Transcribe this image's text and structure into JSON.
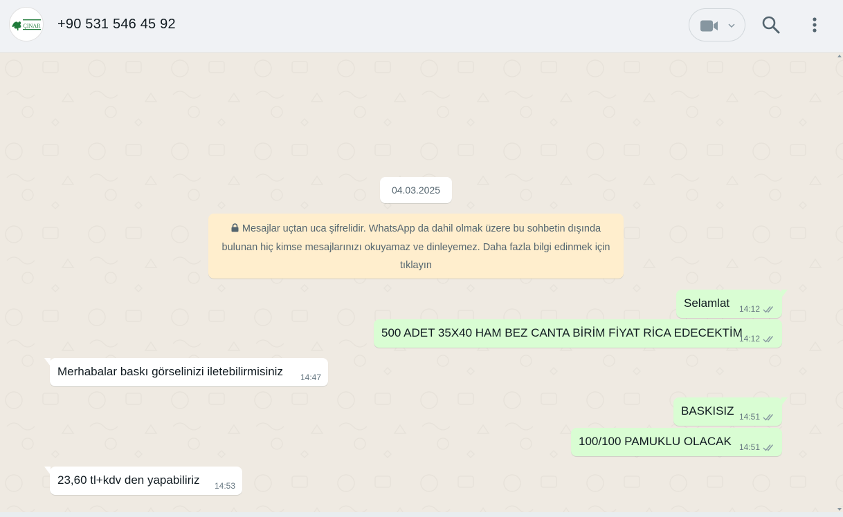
{
  "header": {
    "contact_name": "+90 531 546 45 92",
    "avatar_logo_text": "ÇINAR",
    "icons": [
      "video-camera-icon",
      "chevron-down-icon",
      "search-icon",
      "more-vertical-icon"
    ]
  },
  "chat": {
    "date_chip": "04.03.2025",
    "encryption_notice": "Mesajlar uçtan uca şifrelidir. WhatsApp da dahil olmak üzere bu sohbetin dışında bulunan hiç kimse mesajlarınızı okuyamaz ve dinleyemez. Daha fazla bilgi edinmek için tıklayın",
    "messages": [
      {
        "direction": "out",
        "text": "Selamlat",
        "time": "14:12",
        "status": "read"
      },
      {
        "direction": "out",
        "text": "500 ADET 35X40 HAM BEZ CANTA BİRİM FİYAT RİCA EDECEKTİM",
        "time": "14:12",
        "status": "read"
      },
      {
        "direction": "in",
        "text": "Merhabalar baskı görselinizi iletebilirmisiniz",
        "time": "14:47"
      },
      {
        "direction": "out",
        "text": "BASKISIZ",
        "time": "14:51",
        "status": "read"
      },
      {
        "direction": "out",
        "text": "100/100 PAMUKLU OLACAK",
        "time": "14:51",
        "status": "read"
      },
      {
        "direction": "in",
        "text": "23,60 tl+kdv den yapabiliriz",
        "time": "14:53"
      }
    ]
  },
  "colors": {
    "outgoing_bubble": "#d9fdd3",
    "incoming_bubble": "#ffffff",
    "notice_bg": "#ffeecd",
    "chat_bg": "#efeae2",
    "header_bg": "#f0f2f5",
    "read_ticks": "#8696a0"
  }
}
